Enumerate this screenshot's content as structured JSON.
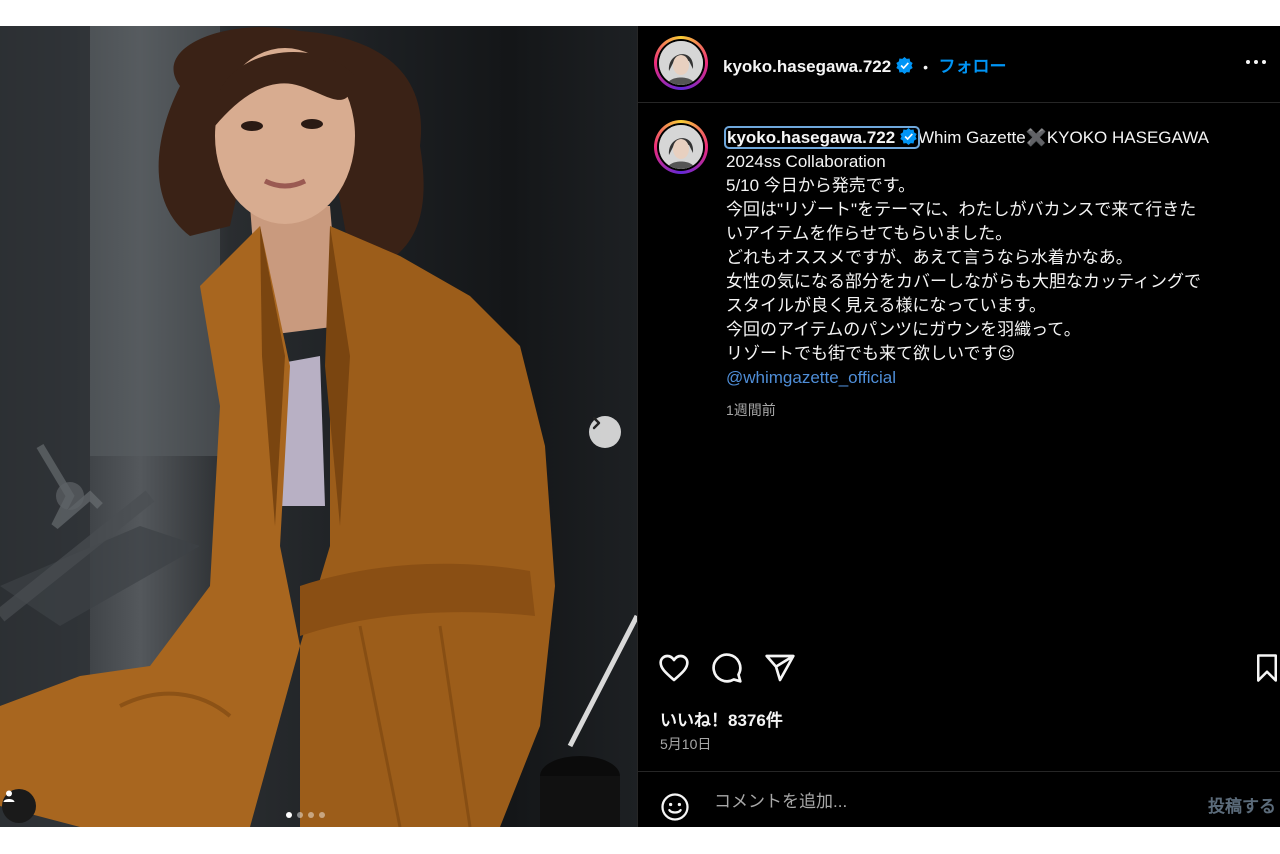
{
  "post": {
    "username": "kyoko.hasegawa.722",
    "follow_label": "フォロー",
    "dot": "•",
    "caption_lines": [
      "Whim Gazette✖️KYOKO HASEGAWA",
      "2024ss Collaboration",
      "5/10 今日から発売です。",
      "今回は\"リゾート\"をテーマに、わたしがバカンスで来て行きた",
      "いアイテムを作らせてもらいました。",
      "どれもオススメですが、あえて言うなら水着かなあ。",
      "女性の気になる部分をカバーしながらも大胆なカッティングで",
      "スタイルが良く見える様になっています。",
      "今回のアイテムのパンツにガウンを羽織って。",
      "リゾートでも街でも来て欲しいです😉"
    ],
    "mention": "@whimgazette_official",
    "caption_time": "1週間前",
    "likes": "いいね！8376件",
    "date": "5月10日",
    "comment_placeholder": "コメントを追加...",
    "post_button": "投稿する",
    "carousel": {
      "total": 4,
      "current": 1
    }
  },
  "icons": {
    "verified": "verified-badge-icon",
    "more": "more-options-icon",
    "like": "heart-icon",
    "comment": "comment-icon",
    "share": "share-icon",
    "save": "bookmark-icon",
    "emoji": "emoji-icon",
    "next": "chevron-right-icon",
    "tag": "user-tag-icon"
  },
  "colors": {
    "background": "#000000",
    "accent": "#0095f6",
    "mention": "#4f8ed8",
    "secondary_text": "#a8a8a8",
    "jacket": "#a8661f"
  }
}
